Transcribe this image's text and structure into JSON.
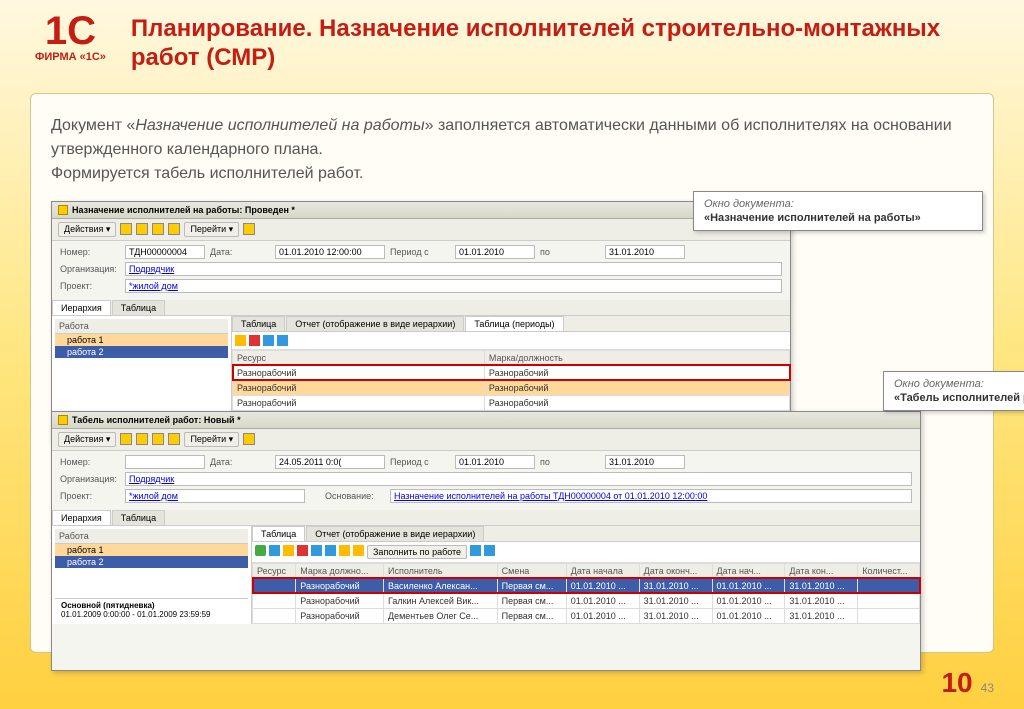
{
  "logo_label": "ФИРМА «1С»",
  "slide_title": "Планирование. Назначение исполнителей строительно-монтажных работ (СМР)",
  "desc_1a": "Документ «",
  "desc_1b": "Назначение исполнителей на работы",
  "desc_1c": "» заполняется автоматически данными об исполнителях на основании утвержденного календарного плана.",
  "desc_2": "Формируется табель исполнителей работ.",
  "callout1": {
    "title": "Окно документа:",
    "body": "«Назначение исполнителей на работы»"
  },
  "callout2": {
    "title": "Окно документа:",
    "body": "«Табель исполнителей работ»"
  },
  "win1": {
    "title": "Назначение исполнителей на работы: Проведен *",
    "actions_label": "Действия ▾",
    "goto_label": "Перейти ▾",
    "labels": {
      "number": "Номер:",
      "date": "Дата:",
      "period_from": "Период с",
      "to": "по",
      "org": "Организация:",
      "project": "Проект:"
    },
    "values": {
      "number": "ТДН00000004",
      "date": "01.01.2010 12:00:00",
      "from": "01.01.2010",
      "to": "31.01.2010",
      "org": "Подрядчик",
      "project": "*жилой дом"
    },
    "left_tabs": [
      "Иерархия",
      "Таблица"
    ],
    "left_head": "Работа",
    "tree": [
      "работа 1",
      "работа 2"
    ],
    "right_tabs": [
      "Таблица",
      "Отчет (отображение в виде иерархии)",
      "Таблица (периоды)"
    ],
    "grid_cols": [
      "Ресурс",
      "Марка/должность"
    ],
    "grid_rows": [
      [
        "Разнорабочий",
        "Разнорабочий"
      ],
      [
        "Разнорабочий",
        "Разнорабочий"
      ],
      [
        "Разнорабочий",
        "Разнорабочий"
      ]
    ]
  },
  "win2": {
    "title": "Табель исполнителей работ: Новый *",
    "actions_label": "Действия ▾",
    "goto_label": "Перейти ▾",
    "labels": {
      "number": "Номер:",
      "date": "Дата:",
      "period_from": "Период с",
      "to": "по",
      "org": "Организация:",
      "project": "Проект:",
      "basis": "Основание:"
    },
    "values": {
      "number": "",
      "date": "24.05.2011  0:0(",
      "from": "01.01.2010",
      "to": "31.01.2010",
      "org": "Подрядчик",
      "project": "*жилой дом",
      "basis": "Назначение исполнителей на работы ТДН00000004 от 01.01.2010 12:00:00"
    },
    "left_tabs": [
      "Иерархия",
      "Таблица"
    ],
    "left_head": "Работа",
    "tree": [
      "работа 1",
      "работа 2"
    ],
    "right_tabs": [
      "Таблица",
      "Отчет (отображение в виде иерархии)"
    ],
    "fill_label": "Заполнить по работе",
    "grid_cols": [
      "Ресурс",
      "Марка должно...",
      "Исполнитель",
      "Смена",
      "Дата начала",
      "Дата оконч...",
      "Дата нач...",
      "Дата кон...",
      "Количест..."
    ],
    "grid_rows": [
      [
        "Разнорабочий",
        "Василенко Алексан...",
        "Первая см...",
        "01.01.2010 ...",
        "31.01.2010 ...",
        "01.01.2010 ...",
        "31.01.2010 ...",
        ""
      ],
      [
        "Разнорабочий",
        "Галкин Алексей Вик...",
        "Первая см...",
        "01.01.2010 ...",
        "31.01.2010 ...",
        "01.01.2010 ...",
        "31.01.2010 ...",
        ""
      ],
      [
        "Разнорабочий",
        "Дементьев Олег Се...",
        "Первая см...",
        "01.01.2010 ...",
        "31.01.2010 ...",
        "01.01.2010 ...",
        "31.01.2010 ...",
        ""
      ]
    ],
    "footer_main": "Основной (пятидневка)",
    "footer_dates": "01.01.2009 0:00:00 - 01.01.2009 23:59:59"
  },
  "page_big": "10",
  "page_sm": "43"
}
